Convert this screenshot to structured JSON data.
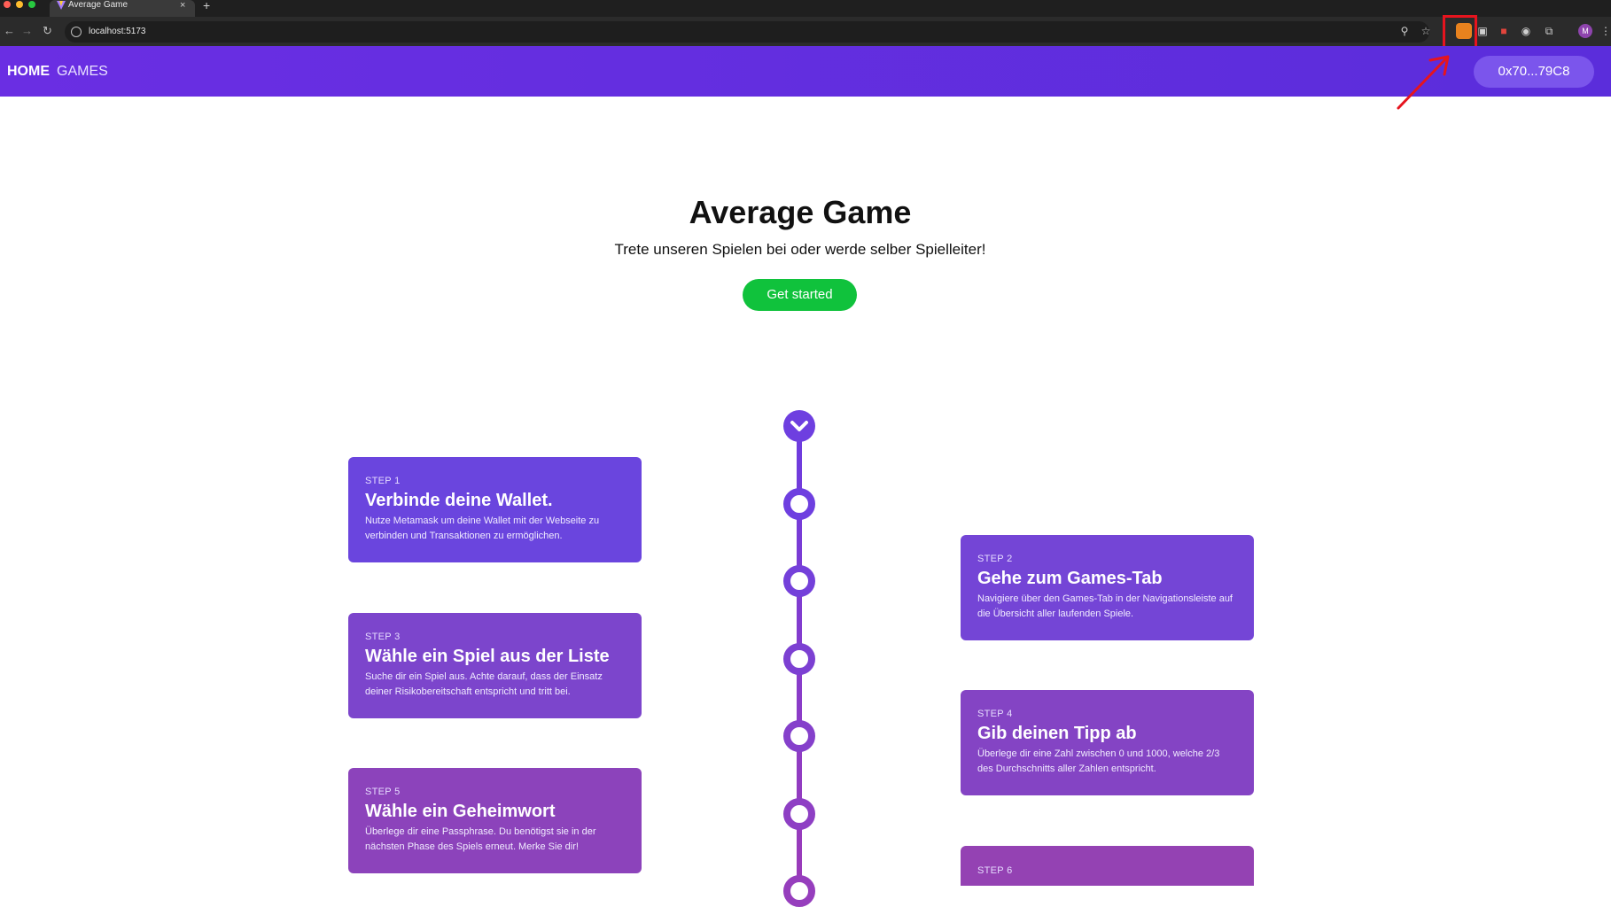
{
  "browser": {
    "tab_title": "Average Game",
    "tab_close": "×",
    "new_tab": "+",
    "url": "localhost:5173",
    "profile_initial": "M"
  },
  "nav": {
    "home": "HOME",
    "games": "GAMES",
    "wallet": "0x70...79C8"
  },
  "hero": {
    "title": "Average Game",
    "subtitle": "Trete unseren Spielen bei oder werde selber Spielleiter!",
    "cta": "Get started"
  },
  "steps": [
    {
      "step": "STEP 1",
      "title": "Verbinde deine Wallet.",
      "desc": "Nutze Metamask um deine Wallet mit der Webseite zu verbinden und Transaktionen zu ermöglichen."
    },
    {
      "step": "STEP 2",
      "title": "Gehe zum Games-Tab",
      "desc": "Navigiere über den Games-Tab in der Navigationsleiste auf die Übersicht aller laufenden Spiele."
    },
    {
      "step": "STEP 3",
      "title": "Wähle ein Spiel aus der Liste",
      "desc": "Suche dir ein Spiel aus. Achte darauf, dass der Einsatz deiner Risikobereitschaft entspricht und tritt bei."
    },
    {
      "step": "STEP 4",
      "title": "Gib deinen Tipp ab",
      "desc": "Überlege dir eine Zahl zwischen 0 und 1000, welche 2/3 des Durchschnitts aller Zahlen entspricht."
    },
    {
      "step": "STEP 5",
      "title": "Wähle ein Geheimwort",
      "desc": "Überlege dir eine Passphrase. Du benötigst sie in der nächsten Phase des Spiels erneut. Merke Sie dir!"
    },
    {
      "step": "STEP 6",
      "title": "",
      "desc": ""
    }
  ],
  "colors": {
    "nav_bg": "#5f2ddf",
    "cta_bg": "#10c23c",
    "highlight": "#e6141e"
  }
}
